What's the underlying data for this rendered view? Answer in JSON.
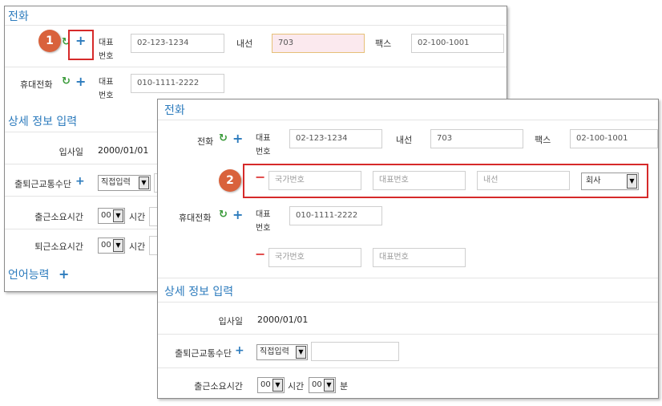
{
  "back": {
    "phone_title": "전화",
    "badge": "1",
    "rep_label": "대표\n번호",
    "phone_value": "02-123-1234",
    "ext_label": "내선",
    "ext_value": "703",
    "fax_label": "팩스",
    "fax_value": "02-100-1001",
    "mobile_label": "휴대전화",
    "mobile_rep_label": "대표\n번호",
    "mobile_value": "010-1111-2222",
    "detail_title": "상세 정보 입력",
    "join_label": "입사일",
    "join_value": "2000/01/01",
    "commute_label": "출퇴근교통수단",
    "commute_select": "직접입력",
    "go_label": "출근소요시간",
    "go_hour": "00",
    "time_label": "시간",
    "leave_label": "퇴근소요시간",
    "leave_hour": "00",
    "language_title": "언어능력"
  },
  "front": {
    "phone_title": "전화",
    "badge": "2",
    "phone_label": "전화",
    "rep_label": "대표\n번호",
    "phone_value": "02-123-1234",
    "ext_label": "내선",
    "ext_value": "703",
    "fax_label": "팩스",
    "fax_value": "02-100-1001",
    "new_row": {
      "country_placeholder": "국가번호",
      "rep_placeholder": "대표번호",
      "ext_placeholder": "내선",
      "type_select": "회사"
    },
    "mobile_label": "휴대전화",
    "mobile_rep_label": "대표\n번호",
    "mobile_value": "010-1111-2222",
    "mobile_new_row": {
      "country_placeholder": "국가번호",
      "rep_placeholder": "대표번호"
    },
    "detail_title": "상세 정보 입력",
    "join_label": "입사일",
    "join_value": "2000/01/01",
    "commute_label": "출퇴근교통수단",
    "commute_select": "직접입력",
    "go_label": "출근소요시간",
    "go_hour": "00",
    "time_label": "시간",
    "go_min": "00",
    "min_label": "분"
  },
  "icons": {
    "plus": "+",
    "minus": "−",
    "refresh": "↻",
    "dropdown": "▼"
  },
  "colors": {
    "accent": "#2c7bbd",
    "badge": "#d9623c",
    "highlight_box": "#d62a2a",
    "refresh": "#3b9b3b",
    "remove": "#e04040"
  }
}
